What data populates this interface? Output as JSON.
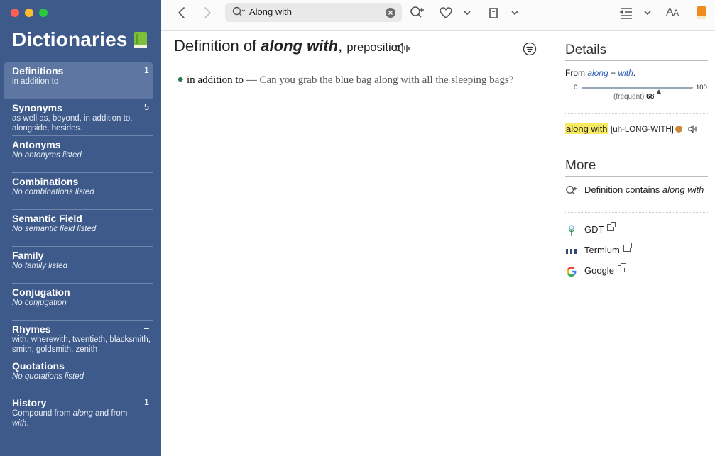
{
  "sidebar": {
    "title": "Dictionaries",
    "items": [
      {
        "name": "Definitions",
        "count": "1",
        "sub": "in addition to",
        "italic": false
      },
      {
        "name": "Synonyms",
        "count": "5",
        "sub": "as well as, beyond, in addition to, alongside, besides.",
        "italic": false
      },
      {
        "name": "Antonyms",
        "count": "",
        "sub": "No antonyms listed",
        "italic": true
      },
      {
        "name": "Combinations",
        "count": "",
        "sub": "No combinations listed",
        "italic": true
      },
      {
        "name": "Semantic Field",
        "count": "",
        "sub": "No semantic field listed",
        "italic": true
      },
      {
        "name": "Family",
        "count": "",
        "sub": "No family listed",
        "italic": true
      },
      {
        "name": "Conjugation",
        "count": "",
        "sub": "No conjugation",
        "italic": true
      },
      {
        "name": "Rhymes",
        "count": "–",
        "sub": "with, wherewith, twentieth, blacksmith, smith, goldsmith, zenith",
        "italic": false
      },
      {
        "name": "Quotations",
        "count": "",
        "sub": "No quotations listed",
        "italic": true
      },
      {
        "name": "History",
        "count": "1",
        "sub_pre": "Compound from ",
        "sub_w1": "along",
        "sub_mid": " and from ",
        "sub_w2": "with",
        "sub_post": "."
      }
    ]
  },
  "toolbar": {
    "search_value": "Along with",
    "font_size_label_large": "A",
    "font_size_label_small": "A"
  },
  "definition": {
    "prefix": "Definition of ",
    "word": "along with",
    "comma": ",",
    "pos": "preposition",
    "entries": [
      {
        "sense": "in addition to",
        "dash": " — ",
        "example": "Can you grab the blue bag along with all the sleeping bags?"
      }
    ]
  },
  "details": {
    "heading": "Details",
    "from_label": "From ",
    "from_w1": "along",
    "from_plus": " + ",
    "from_w2": "with",
    "from_end": ".",
    "freq_min": "0",
    "freq_max": "100",
    "freq_label": "(frequent)",
    "freq_value": "68",
    "pron_word": "along with",
    "pron_ipa": "[uh-LONG-WITH]"
  },
  "more": {
    "heading": "More",
    "contains_prefix": "Definition contains ",
    "contains_word": "along with",
    "links": [
      {
        "label": "GDT"
      },
      {
        "label": "Termium"
      },
      {
        "label": "Google"
      }
    ]
  },
  "colors": {
    "sidebar_bg": "#3e5a8a",
    "selected_bg": "#5d77a2",
    "highlight": "#f6ea62",
    "link": "#2d5db5"
  }
}
